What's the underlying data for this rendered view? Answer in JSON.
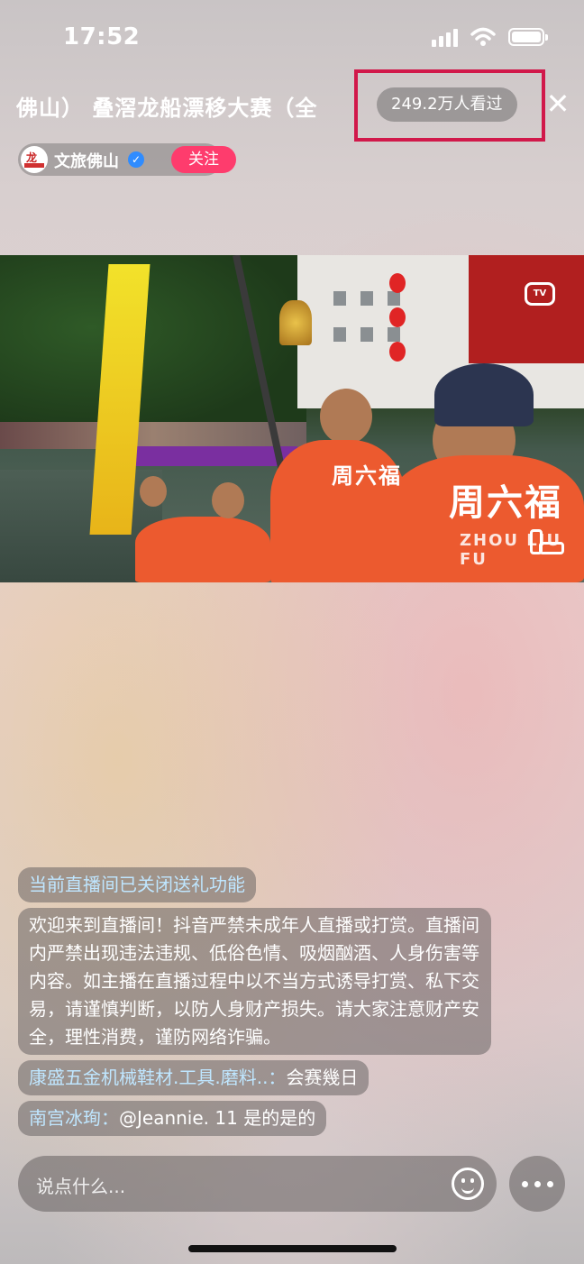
{
  "status_bar": {
    "time": "17:52"
  },
  "header": {
    "live_title": "佛山） 叠滘龙船漂移大赛（全",
    "viewer_count": "249.2万人看过",
    "close_icon": "close-icon"
  },
  "host": {
    "name": "文旅佛山",
    "follow_label": "关注",
    "verified_icon": "verified-badge-icon"
  },
  "video": {
    "tv_icon_label": "TV",
    "shirt_text": "周六福",
    "shirt_subtext": "ZHOU LIU FU"
  },
  "chat": {
    "messages": [
      {
        "type": "system",
        "text": "当前直播间已关闭送礼功能"
      },
      {
        "type": "system",
        "text": "欢迎来到直播间！抖音严禁未成年人直播或打赏。直播间内严禁出现违法违规、低俗色情、吸烟酗酒、人身伤害等内容。如主播在直播过程中以不当方式诱导打赏、私下交易，请谨慎判断，以防人身财产损失。请大家注意财产安全，理性消费，谨防网络诈骗。"
      },
      {
        "type": "user",
        "user": "康盛五金机械鞋材.工具.磨料..：",
        "text": "会赛幾日"
      },
      {
        "type": "user",
        "user": "南宫冰珣：",
        "text": "@Jeannie. 11 是的是的"
      }
    ]
  },
  "input": {
    "placeholder": "说点什么..."
  },
  "colors": {
    "follow": "#fe3c6d",
    "highlight_box": "#d1184a",
    "username": "#bfe6ff"
  }
}
